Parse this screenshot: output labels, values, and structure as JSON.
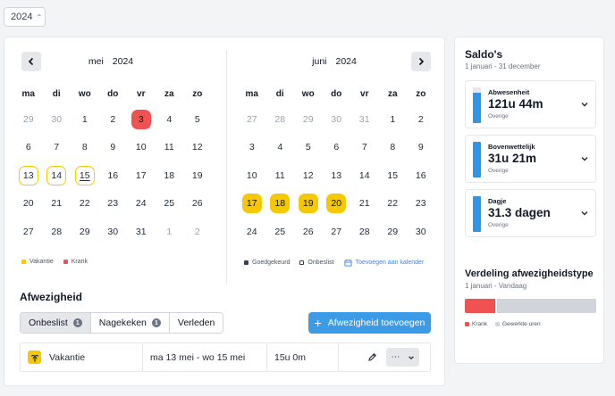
{
  "year_select": {
    "value": "2024"
  },
  "colors": {
    "sick": "#f05252",
    "vacation": "#f5c800",
    "approved": "#374151",
    "primary": "#3b9be6",
    "work": "#d1d5db"
  },
  "calendar_left": {
    "month": "mei",
    "year": "2024",
    "weekdays": [
      "ma",
      "di",
      "wo",
      "do",
      "vr",
      "za",
      "zo"
    ],
    "days": [
      {
        "d": "29",
        "muted": true
      },
      {
        "d": "30",
        "muted": true
      },
      {
        "d": "1"
      },
      {
        "d": "2"
      },
      {
        "d": "3",
        "state": "sick"
      },
      {
        "d": "4"
      },
      {
        "d": "5"
      },
      {
        "d": "6"
      },
      {
        "d": "7"
      },
      {
        "d": "8"
      },
      {
        "d": "9"
      },
      {
        "d": "10"
      },
      {
        "d": "11"
      },
      {
        "d": "12"
      },
      {
        "d": "13",
        "state": "vac-out"
      },
      {
        "d": "14",
        "state": "vac-out"
      },
      {
        "d": "15",
        "state": "vac-out",
        "today": true
      },
      {
        "d": "16"
      },
      {
        "d": "17"
      },
      {
        "d": "18"
      },
      {
        "d": "19"
      },
      {
        "d": "20"
      },
      {
        "d": "21"
      },
      {
        "d": "22"
      },
      {
        "d": "23"
      },
      {
        "d": "24"
      },
      {
        "d": "25"
      },
      {
        "d": "26"
      },
      {
        "d": "27"
      },
      {
        "d": "28"
      },
      {
        "d": "29"
      },
      {
        "d": "30"
      },
      {
        "d": "31"
      },
      {
        "d": "1",
        "muted": true
      },
      {
        "d": "2",
        "muted": true
      }
    ]
  },
  "calendar_right": {
    "month": "juni",
    "year": "2024",
    "weekdays": [
      "ma",
      "di",
      "wo",
      "do",
      "vr",
      "za",
      "zo"
    ],
    "days": [
      {
        "d": "27",
        "muted": true
      },
      {
        "d": "28",
        "muted": true
      },
      {
        "d": "29",
        "muted": true
      },
      {
        "d": "30",
        "muted": true
      },
      {
        "d": "31",
        "muted": true
      },
      {
        "d": "1"
      },
      {
        "d": "2"
      },
      {
        "d": "3"
      },
      {
        "d": "4"
      },
      {
        "d": "5"
      },
      {
        "d": "6"
      },
      {
        "d": "7"
      },
      {
        "d": "8"
      },
      {
        "d": "9"
      },
      {
        "d": "10"
      },
      {
        "d": "11"
      },
      {
        "d": "12"
      },
      {
        "d": "13"
      },
      {
        "d": "14"
      },
      {
        "d": "15"
      },
      {
        "d": "16"
      },
      {
        "d": "17",
        "state": "vac-fill"
      },
      {
        "d": "18",
        "state": "vac-fill"
      },
      {
        "d": "19",
        "state": "vac-fill"
      },
      {
        "d": "20",
        "state": "vac-fill"
      },
      {
        "d": "21"
      },
      {
        "d": "22"
      },
      {
        "d": "23"
      },
      {
        "d": "24"
      },
      {
        "d": "25"
      },
      {
        "d": "26"
      },
      {
        "d": "27"
      },
      {
        "d": "28"
      },
      {
        "d": "29"
      },
      {
        "d": "30"
      }
    ]
  },
  "legend_left": {
    "vacation": "Vakantie",
    "sick": "Krank"
  },
  "legend_right": {
    "approved": "Goedgekeurd",
    "unreviewed": "Onbeslist",
    "add_calendar": "Toevoegen aan kalender"
  },
  "absence": {
    "title": "Afwezigheid",
    "tabs": [
      {
        "label": "Onbeslist",
        "badge": "1"
      },
      {
        "label": "Nagekeken",
        "badge": "1"
      },
      {
        "label": "Verleden"
      }
    ],
    "add_button": "Afwezigheid toevoegen",
    "row": {
      "type": "Vakantie",
      "period": "ma 13 mei - wo 15 mei",
      "duration": "15u 0m"
    }
  },
  "saldo": {
    "title": "Saldo's",
    "subtitle": "1 januari - 31 december",
    "items": [
      {
        "label": "Abwesenheit",
        "value": "121u 44m",
        "note": "Overige",
        "fill": 0.85
      },
      {
        "label": "Bovenwettelijk",
        "value": "31u 21m",
        "note": "Overige",
        "fill": 1.0
      },
      {
        "label": "Dagje",
        "value": "31.3 dagen",
        "note": "Overige",
        "fill": 1.0
      }
    ]
  },
  "distribution": {
    "title": "Verdeling afwezigheidstype",
    "subtitle": "1 januari - Vandaag",
    "segments": [
      {
        "name": "Krank",
        "share": 0.23
      },
      {
        "name": "Gewerkte uren",
        "share": 0.77
      }
    ]
  }
}
